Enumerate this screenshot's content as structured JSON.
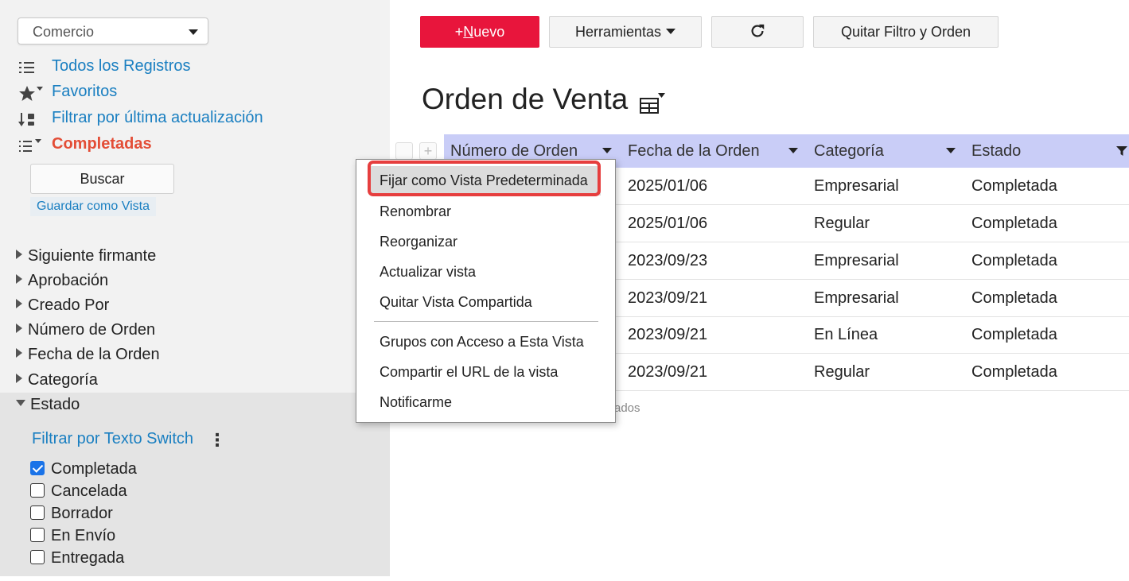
{
  "sidebar": {
    "app_select": "Comercio",
    "nav": [
      {
        "label": "Todos los Registros",
        "icon": "list-icon"
      },
      {
        "label": "Favoritos",
        "icon": "star-filter-icon"
      },
      {
        "label": "Filtrar por última actualización",
        "icon": "sort-update-icon"
      },
      {
        "label": "Completadas",
        "icon": "list-filter-icon"
      }
    ],
    "buscar_label": "Buscar",
    "save_view_label": "Guardar como Vista",
    "facets": [
      "Siguiente firmante",
      "Aprobación",
      "Creado Por",
      "Número de Orden",
      "Fecha de la Orden",
      "Categoría"
    ],
    "estado_label": "Estado",
    "filter_switch_label": "Filtrar por Texto Switch",
    "estado_options": [
      {
        "label": "Completada",
        "checked": true
      },
      {
        "label": "Cancelada",
        "checked": false
      },
      {
        "label": "Borrador",
        "checked": false
      },
      {
        "label": "En Envío",
        "checked": false
      },
      {
        "label": "Entregada",
        "checked": false
      }
    ]
  },
  "toolbar": {
    "new_prefix": "+",
    "new_underlined": "N",
    "new_rest": "uevo",
    "tools_label": "Herramientas",
    "refresh_icon": "refresh-icon",
    "clear_label": "Quitar Filtro y Orden"
  },
  "page_title": "Orden de Venta",
  "table": {
    "columns": [
      "Número de Orden",
      "Fecha de la Orden",
      "Categoría",
      "Estado"
    ],
    "rows": [
      {
        "fecha": "2025/01/06",
        "categoria": "Empresarial",
        "estado": "Completada"
      },
      {
        "fecha": "2025/01/06",
        "categoria": "Regular",
        "estado": "Completada"
      },
      {
        "fecha": "2023/09/23",
        "categoria": "Empresarial",
        "estado": "Completada"
      },
      {
        "fecha": "2023/09/21",
        "categoria": "Empresarial",
        "estado": "Completada"
      },
      {
        "fecha": "2023/09/21",
        "categoria": "En Línea",
        "estado": "Completada"
      },
      {
        "fecha": "2023/09/21",
        "categoria": "Regular",
        "estado": "Completada"
      }
    ],
    "footer_fragment": "ados"
  },
  "context_menu": {
    "items": [
      "Fijar como Vista Predeterminada",
      "Renombrar",
      "Reorganizar",
      "Actualizar vista",
      "Quitar Vista Compartida",
      "Grupos con Acceso a Esta Vista",
      "Compartir el URL de la vista",
      "Notificarme"
    ]
  },
  "colors": {
    "primary_button": "#e8153c",
    "link": "#1a7fc1",
    "active_view": "#e34d36",
    "table_header": "#c9cdf7",
    "highlight_ring": "#e63e3e"
  }
}
